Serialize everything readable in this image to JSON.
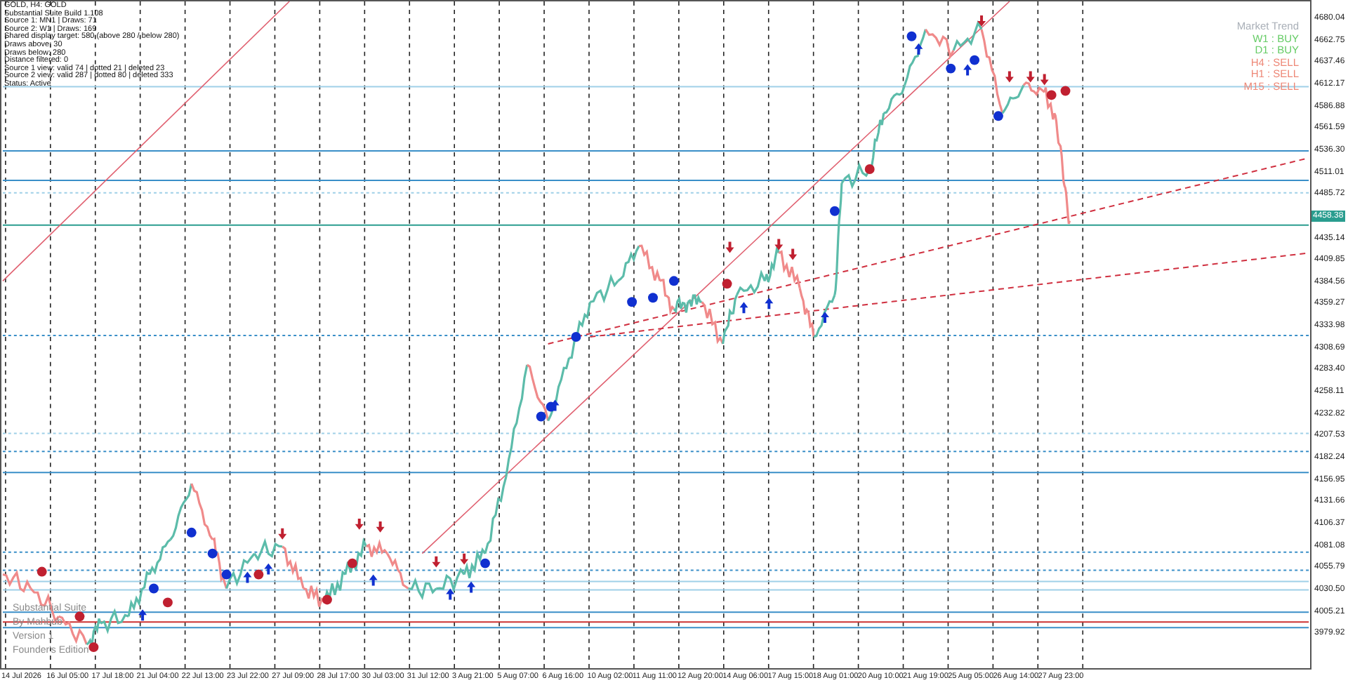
{
  "info_lines": [
    "GOLD, H4: GOLD",
    "Substantial Suite Build 1.108",
    "Source 1: MN1 | Draws: 71",
    "Source 2: W1 | Draws: 169",
    "Shared display target: 580 (above 280 / below 280)",
    "Draws above: 30",
    "Draws below: 280",
    "Distance filtered: 0",
    "Source 1 view: valid 74 | dotted 21 | deleted 23",
    "Source 2 view: valid 287 | dotted 80 | deleted 333",
    "Status: Active"
  ],
  "market_trend": {
    "title": "Market Trend",
    "items": [
      {
        "label": "W1 : BUY",
        "color": "#66cc66"
      },
      {
        "label": "D1 : BUY",
        "color": "#66cc66"
      },
      {
        "label": "H4 : SELL",
        "color": "#ee8877"
      },
      {
        "label": "H1 : SELL",
        "color": "#ee8877"
      },
      {
        "label": "M15 : SELL",
        "color": "#ee8877"
      }
    ]
  },
  "branding": [
    "Substantial Suite",
    "By Mahbub",
    "Version 1",
    "Founder's Edition"
  ],
  "price_axis": {
    "labels": [
      "4680.04",
      "4662.75",
      "4637.46",
      "4612.17",
      "4586.88",
      "4561.59",
      "4536.30",
      "4511.01",
      "4485.72",
      "4435.14",
      "4409.85",
      "4384.56",
      "4359.27",
      "4333.98",
      "4308.69",
      "4283.40",
      "4258.11",
      "4232.82",
      "4207.53",
      "4182.24",
      "4156.95",
      "4131.66",
      "4106.37",
      "4081.08",
      "4055.79",
      "4030.50",
      "4005.21",
      "3979.92"
    ],
    "current_price": "4458.38"
  },
  "time_axis": {
    "labels": [
      "14 Jul 2026",
      "16 Jul 05:00",
      "17 Jul 18:00",
      "21 Jul 04:00",
      "22 Jul 13:00",
      "23 Jul 22:00",
      "27 Jul 09:00",
      "28 Jul 17:00",
      "30 Jul 03:00",
      "31 Jul 12:00",
      "3 Aug 21:00",
      "5 Aug 07:00",
      "6 Aug 16:00",
      "10 Aug 02:00",
      "11 Aug 11:00",
      "12 Aug 20:00",
      "14 Aug 06:00",
      "17 Aug 15:00",
      "18 Aug 01:00",
      "20 Aug 10:00",
      "21 Aug 19:00",
      "25 Aug 05:00",
      "26 Aug 14:00",
      "27 Aug 23:00"
    ]
  }
}
